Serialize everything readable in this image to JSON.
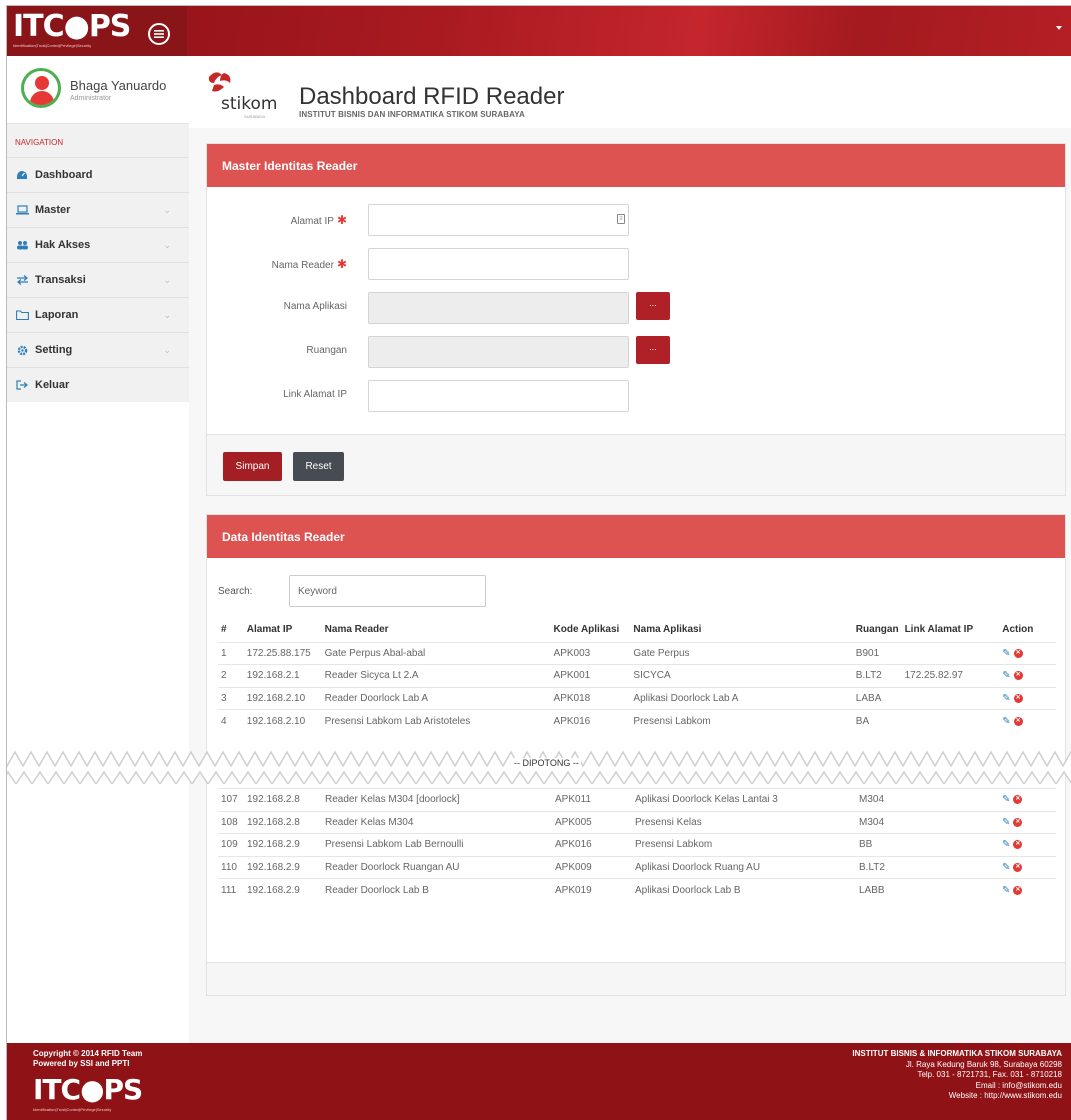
{
  "brand": {
    "name": "ITC●PS",
    "tagline": "Identification|Trust|Control|Privilege|Security"
  },
  "user": {
    "name": "Bhaga Yanuardo",
    "role": "Administrator"
  },
  "nav": {
    "heading": "NAVIGATION",
    "items": [
      {
        "label": "Dashboard",
        "icon": "dashboard-icon",
        "expandable": false
      },
      {
        "label": "Master",
        "icon": "laptop-icon",
        "expandable": true
      },
      {
        "label": "Hak Akses",
        "icon": "users-icon",
        "expandable": true
      },
      {
        "label": "Transaksi",
        "icon": "exchange-icon",
        "expandable": true
      },
      {
        "label": "Laporan",
        "icon": "folder-icon",
        "expandable": true
      },
      {
        "label": "Setting",
        "icon": "gear-icon",
        "expandable": true
      },
      {
        "label": "Keluar",
        "icon": "sign-out-icon",
        "expandable": false
      }
    ]
  },
  "header": {
    "logo_word": "stikom",
    "logo_small": "SURABAYA",
    "title": "Dashboard RFID Reader",
    "subtitle": "INSTITUT BISNIS DAN INFORMATIKA STIKOM SURABAYA"
  },
  "form": {
    "title": "Master Identitas Reader",
    "fields": [
      {
        "label": "Alamat IP",
        "required": true,
        "value": "",
        "disabled": false
      },
      {
        "label": "Nama Reader",
        "required": true,
        "value": "",
        "disabled": false
      },
      {
        "label": "Nama Aplikasi",
        "required": false,
        "value": "",
        "disabled": true
      },
      {
        "label": "Ruangan",
        "required": false,
        "value": "",
        "disabled": true
      },
      {
        "label": "Link Alamat IP",
        "required": false,
        "value": "",
        "disabled": false
      }
    ],
    "picker_label": "...",
    "save_label": "Simpan",
    "reset_label": "Reset"
  },
  "data": {
    "title": "Data Identitas Reader",
    "search_label": "Search:",
    "search_placeholder": "Keyword",
    "columns": [
      "#",
      "Alamat IP",
      "Nama Reader",
      "Kode Aplikasi",
      "Nama Aplikasi",
      "Ruangan",
      "Link Alamat IP",
      "Action"
    ],
    "rows_top": [
      [
        "1",
        "172.25.88.175",
        "Gate Perpus Abal-abal",
        "APK003",
        "Gate Perpus",
        "B901",
        ""
      ],
      [
        "2",
        "192.168.2.1",
        "Reader Sicyca Lt 2.A",
        "APK001",
        "SICYCA",
        "B.LT2",
        "172.25.82.97"
      ],
      [
        "3",
        "192.168.2.10",
        "Reader Doorlock Lab A",
        "APK018",
        "Aplikasi Doorlock Lab A",
        "LABA",
        ""
      ],
      [
        "4",
        "192.168.2.10",
        "Presensi Labkom Lab Aristoteles",
        "APK016",
        "Presensi Labkom",
        "BA",
        ""
      ]
    ],
    "cut_label": "-- DIPOTONG --",
    "rows_bottom": [
      [
        "107",
        "192.168.2.8",
        "Reader Kelas M304 [doorlock]",
        "APK011",
        "Aplikasi Doorlock Kelas Lantai 3",
        "M304",
        ""
      ],
      [
        "108",
        "192.168.2.8",
        "Reader Kelas M304",
        "APK005",
        "Presensi Kelas",
        "M304",
        ""
      ],
      [
        "109",
        "192.168.2.9",
        "Presensi Labkom Lab Bernoulli",
        "APK016",
        "Presensi Labkom",
        "BB",
        ""
      ],
      [
        "110",
        "192.168.2.9",
        "Reader Doorlock Ruangan AU",
        "APK009",
        "Aplikasi Doorlock Ruang AU",
        "B.LT2",
        ""
      ],
      [
        "111",
        "192.168.2.9",
        "Reader Doorlock Lab B",
        "APK019",
        "Aplikasi Doorlock Lab B",
        "LABB",
        ""
      ]
    ]
  },
  "footer": {
    "copyright": "Copyright © 2014 RFID Team",
    "powered": "Powered by SSI and PPTI",
    "inst": "INSTITUT BISNIS & INFORMATIKA STIKOM SURABAYA",
    "address": "Jl. Raya Kedung Baruk 98, Surabaya 60298",
    "phone": "Telp. 031 - 8721731, Fax. 031 - 8710218",
    "email": "Email : info@stikom.edu",
    "website": "Website : http://www.stikom.edu"
  },
  "colors": {
    "brand_red": "#a31f23",
    "panel_red": "#dd5352",
    "reset_dark": "#474c52",
    "edit_blue": "#2e7fb8",
    "delete_red": "#e53935"
  }
}
